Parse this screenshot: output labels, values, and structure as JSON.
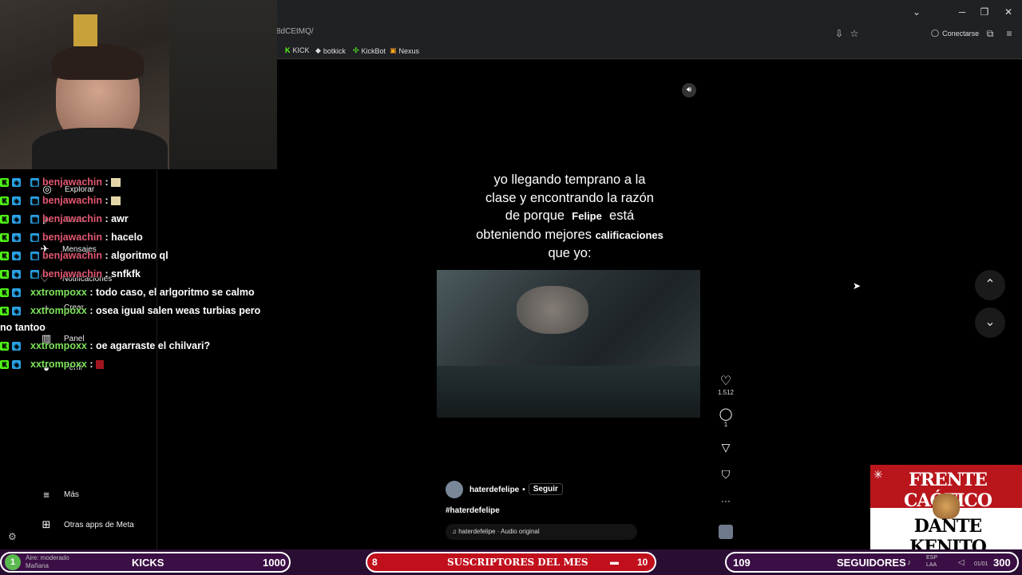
{
  "browser": {
    "url_fragment": "8dCEtMQ/",
    "connect_label": "Conectarse",
    "bookmarks": [
      {
        "label": "KICK",
        "icon": "kick-icon"
      },
      {
        "label": "botkick",
        "icon": "diamond-icon"
      },
      {
        "label": "KickBot",
        "icon": "kickbot-icon"
      },
      {
        "label": "Nexus",
        "icon": "nexus-icon"
      }
    ]
  },
  "leftnav": {
    "items": [
      {
        "label": "Explorar",
        "icon": "compass-icon"
      },
      {
        "label": "Reels",
        "icon": "reels-icon"
      },
      {
        "label": "Mensajes",
        "icon": "messages-icon"
      },
      {
        "label": "Notificaciones",
        "icon": "heart-icon"
      },
      {
        "label": "Crear",
        "icon": "plus-icon"
      },
      {
        "label": "Panel",
        "icon": "chart-icon"
      },
      {
        "label": "Perfil",
        "icon": "profile-icon"
      }
    ],
    "more_label": "Más",
    "meta_label": "Otras apps de Meta"
  },
  "chat": [
    {
      "user": "benjawachin",
      "msg": "",
      "emote": true,
      "badge2": "b"
    },
    {
      "user": "benjawachin",
      "msg": "",
      "emote": true,
      "badge2": "b"
    },
    {
      "user": "benjawachin",
      "msg": "awr",
      "badge2": "b"
    },
    {
      "user": "benjawachin",
      "msg": "hacelo",
      "badge2": "b"
    },
    {
      "user": "benjawachin",
      "msg": "algoritmo ql",
      "badge2": "b"
    },
    {
      "user": "benjawachin",
      "msg": "snfkfk",
      "badge2": "b"
    },
    {
      "user": "xxtrompoxx",
      "msg": "todo caso, el arlgoritmo se calmo",
      "badge2": "b"
    },
    {
      "user": "xxtrompoxx",
      "msg": "osea igual salen weas turbias pero",
      "badge2": "b"
    },
    {
      "user": "xxtrompoxx",
      "msg": "oe agarraste el chilvari?",
      "badge2": "b"
    },
    {
      "user": "xxtrompoxx",
      "msg": "",
      "emote": true,
      "badge2": "b"
    }
  ],
  "chat_wrap": "no tantoo",
  "reel": {
    "caption_l1": "yo llegando temprano a la",
    "caption_l2": "clase y encontrando la razón",
    "caption_l3a": "de porque",
    "caption_l3b": "Felipe",
    "caption_l3c": "está",
    "caption_l4a": "obteniendo mejores",
    "caption_l4b": "calificaciones",
    "caption_l5": "que yo:",
    "username": "haterdefelipe",
    "follow": "Seguir",
    "hashtag": "#haterdefelipe",
    "audio": "haterdefelipe · Audio original",
    "likes": "1.512",
    "comments": "1"
  },
  "promo": {
    "line1": "FRENTE CAÓTICO",
    "line2": "DANTE KENITO"
  },
  "bottom": {
    "weather_num": "1",
    "weather_l1": "Aire: moderado",
    "weather_l2": "Mañana",
    "kicks_label": "KICKS",
    "kicks_value": "1000",
    "subs_num": "8",
    "subs_label": "SUSCRIPTORES DEL MES",
    "subs_value": "10",
    "followers_num": "109",
    "followers_label": "SEGUIDORES",
    "followers_value": "300",
    "lang1": "ESP",
    "lang2": "LAA",
    "date": "01/01"
  }
}
